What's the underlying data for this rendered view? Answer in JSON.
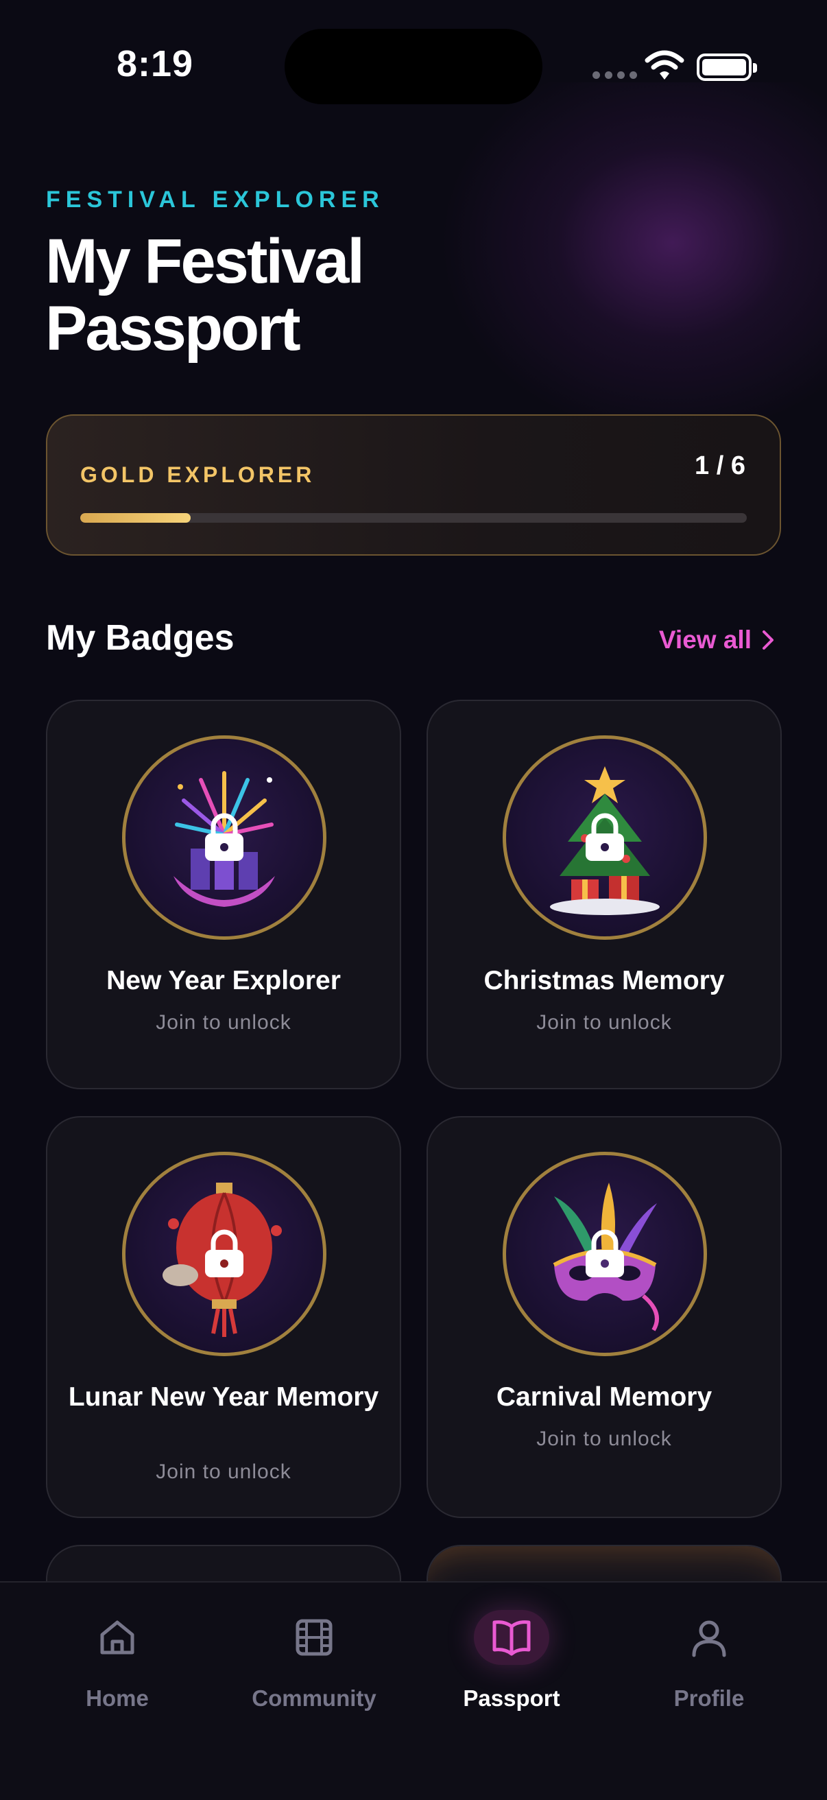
{
  "status_bar": {
    "time": "8:19"
  },
  "header": {
    "kicker": "FESTIVAL EXPLORER",
    "title": "My Festival Passport"
  },
  "explorer": {
    "label": "GOLD EXPLORER",
    "count": "1 / 6",
    "progress_fraction": 0.166,
    "accent_color": "#f3c567"
  },
  "badges_section": {
    "title": "My Badges",
    "view_all": "View all",
    "view_all_color": "#e95ad2"
  },
  "badges": [
    {
      "name": "New Year Explorer",
      "status": "Join to unlock",
      "art": "fireworks-icon",
      "locked": true
    },
    {
      "name": "Christmas Memory",
      "status": "Join to unlock",
      "art": "christmas-tree-icon",
      "locked": true
    },
    {
      "name": "Lunar New Year Memory",
      "status": "Join to unlock",
      "art": "lantern-icon",
      "locked": true
    },
    {
      "name": "Carnival Memory",
      "status": "Join to unlock",
      "art": "carnival-mask-icon",
      "locked": true
    }
  ],
  "tabbar": {
    "tabs": [
      {
        "label": "Home",
        "icon": "home-icon",
        "active": false
      },
      {
        "label": "Community",
        "icon": "film-icon",
        "active": false
      },
      {
        "label": "Passport",
        "icon": "open-book-icon",
        "active": true
      },
      {
        "label": "Profile",
        "icon": "person-icon",
        "active": false
      }
    ],
    "active_color": "#e95ad2"
  }
}
